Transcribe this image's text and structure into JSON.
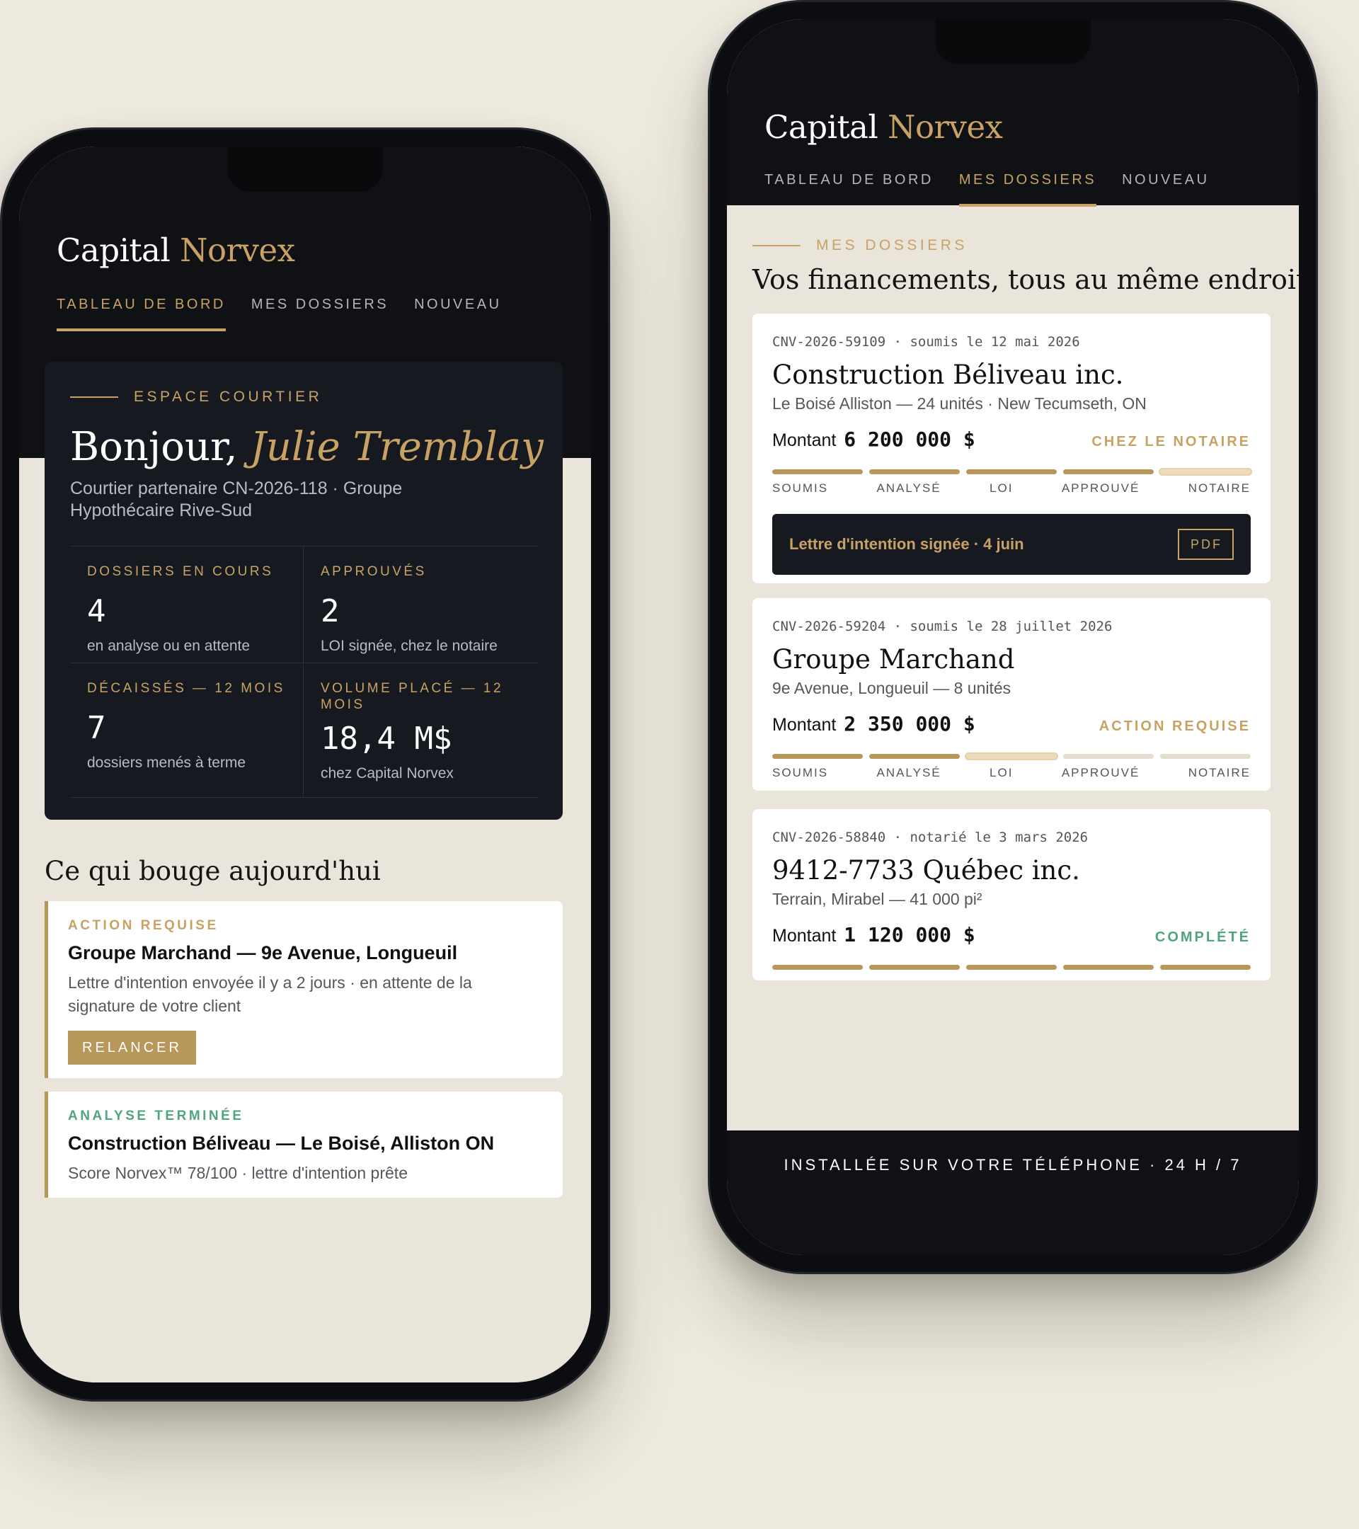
{
  "brand": {
    "name_main": "Capital",
    "name_accent": "Norvex"
  },
  "tabs": [
    {
      "label": "TABLEAU DE BORD"
    },
    {
      "label": "MES DOSSIERS"
    },
    {
      "label": "NOUVEAU"
    }
  ],
  "dashboard": {
    "active_tab": "TABLEAU DE BORD",
    "eyebrow": "ESPACE COURTIER",
    "greeting_prefix": "Bonjour,",
    "greeting_name": "Julie Tremblay",
    "partner_line": "Courtier partenaire CN-2026-118 · Groupe Hypothécaire Rive-Sud",
    "stats": [
      {
        "label": "DOSSIERS EN COURS",
        "value": "4",
        "sub": "en analyse ou en attente"
      },
      {
        "label": "APPROUVÉS",
        "value": "2",
        "sub": "LOI signée, chez le notaire"
      },
      {
        "label": "DÉCAISSÉS — 12 MOIS",
        "value": "7",
        "sub": "dossiers menés à terme"
      },
      {
        "label": "VOLUME PLACÉ — 12 MOIS",
        "value": "18,4 M$",
        "sub": "chez Capital Norvex"
      }
    ],
    "section_title": "Ce qui bouge aujourd'hui",
    "activities": [
      {
        "kind": "ACTION REQUISE",
        "title": "Groupe Marchand — 9e Avenue, Longueuil",
        "desc": "Lettre d'intention envoyée il y a 2 jours · en attente de la signature de votre client",
        "button": "RELANCER"
      },
      {
        "kind": "ANALYSE TERMINÉE",
        "title": "Construction Béliveau — Le Boisé, Alliston ON",
        "desc": "Score Norvex™ 78/100 · lettre d'intention prête"
      }
    ]
  },
  "dossiers_page": {
    "active_tab": "MES DOSSIERS",
    "eyebrow": "MES DOSSIERS",
    "title": "Vos financements, tous au même endroit",
    "step_labels": [
      "SOUMIS",
      "ANALYSÉ",
      "LOI",
      "APPROUVÉ",
      "NOTAIRE"
    ],
    "amount_label": "Montant",
    "dossiers": [
      {
        "meta": "CNV-2026-59109 · soumis le 12 mai 2026",
        "name": "Construction Béliveau inc.",
        "address": "Le Boisé Alliston — 24 unités · New Tecumseth, ON",
        "amount": "6 200 000 $",
        "status": "CHEZ LE NOTAIRE",
        "status_color": "#c8a265",
        "steps_completed": 4,
        "current_step": 5,
        "banner_text": "Lettre d'intention signée · 4 juin",
        "banner_button": "PDF"
      },
      {
        "meta": "CNV-2026-59204 · soumis le 28 juillet 2026",
        "name": "Groupe Marchand",
        "address": "9e Avenue, Longueuil — 8 unités",
        "amount": "2 350 000 $",
        "status": "ACTION REQUISE",
        "status_color": "#c8a265",
        "steps_completed": 2,
        "current_step": 3
      },
      {
        "meta": "CNV-2026-58840 · notarié le 3 mars 2026",
        "name": "9412-7733 Québec inc.",
        "address": "Terrain, Mirabel — 41 000 pi²",
        "amount": "1 120 000 $",
        "status": "COMPLÉTÉ",
        "status_color": "#4fa57e",
        "steps_completed": 5,
        "current_step": 0
      }
    ],
    "footer": "INSTALLÉE SUR VOTRE TÉLÉPHONE · 24 H / 7"
  }
}
